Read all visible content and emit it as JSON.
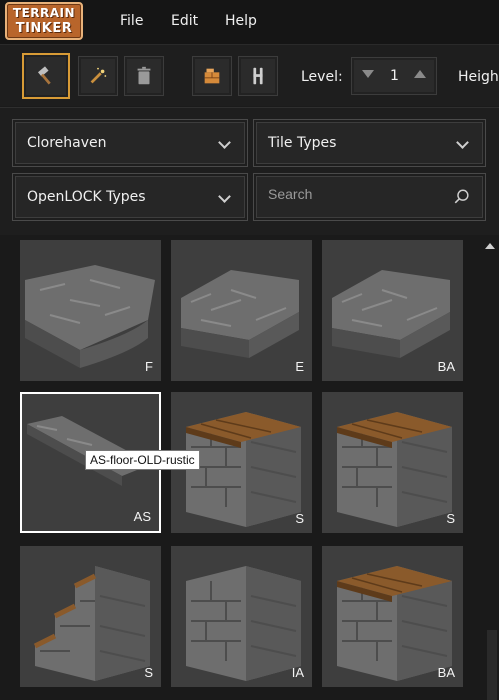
{
  "app": {
    "logo_line1": "TERRAIN",
    "logo_line2": "TINKER",
    "menu": [
      "File",
      "Edit",
      "Help"
    ]
  },
  "toolbar": {
    "tools": [
      {
        "name": "hammer-tool",
        "icon": "hammer-icon",
        "active": true
      },
      {
        "name": "magic-wand-tool",
        "icon": "magic-wand-icon",
        "active": false
      },
      {
        "name": "delete-tool",
        "icon": "trash-icon",
        "active": false
      },
      {
        "name": "block-tool",
        "icon": "brick-block-icon",
        "active": false
      },
      {
        "name": "connector-tool",
        "icon": "clip-icon",
        "active": false
      }
    ],
    "level_label": "Level:",
    "level_value": "1",
    "height_label": "Height:"
  },
  "filters": {
    "collection": "Clorehaven",
    "tile_types": "Tile Types",
    "openlock_types": "OpenLOCK Types",
    "search_placeholder": "Search"
  },
  "tiles": [
    {
      "code": "F",
      "kind": "quarter-floor"
    },
    {
      "code": "E",
      "kind": "floor"
    },
    {
      "code": "BA",
      "kind": "floor"
    },
    {
      "code": "AS",
      "kind": "thin-floor",
      "selected": true
    },
    {
      "code": "S",
      "kind": "wall-wood"
    },
    {
      "code": "S",
      "kind": "wall-wood-tall"
    },
    {
      "code": "S",
      "kind": "wall-stair"
    },
    {
      "code": "IA",
      "kind": "wall"
    },
    {
      "code": "BA",
      "kind": "wall-wood"
    }
  ],
  "tooltip": "AS-floor-OLD-rustic",
  "colors": {
    "accent": "#d89b36",
    "logo": "#b8652b",
    "stone": "#6e6e6e",
    "wood": "#8a5a2b"
  }
}
